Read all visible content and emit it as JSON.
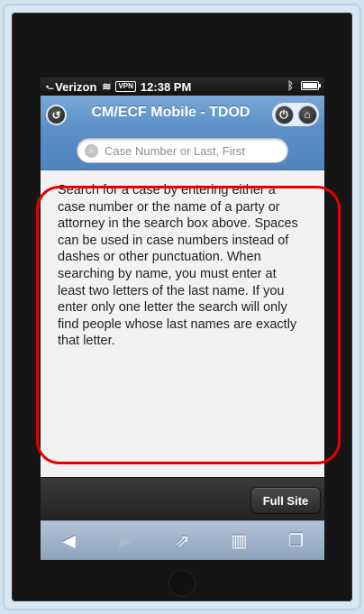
{
  "status": {
    "signal": "•....",
    "carrier": "Verizon",
    "vpn": "VPN",
    "time": "12:38 PM"
  },
  "header": {
    "title": "CM/ECF Mobile - TDOD"
  },
  "search": {
    "placeholder": "Case Number or Last, First"
  },
  "content": {
    "help_text": "Search for a case by entering either a case number or the name of a party or attorney in the search box above. Spaces can be used in case numbers instead of dashes or other punctuation. When searching by name, you must enter at least two letters of the last name. If you enter only one letter the search will only find people whose last names are exactly that letter."
  },
  "footer": {
    "full_site_label": "Full Site"
  },
  "colors": {
    "header_blue": "#5b8fc6",
    "highlight_red": "#e30000"
  }
}
